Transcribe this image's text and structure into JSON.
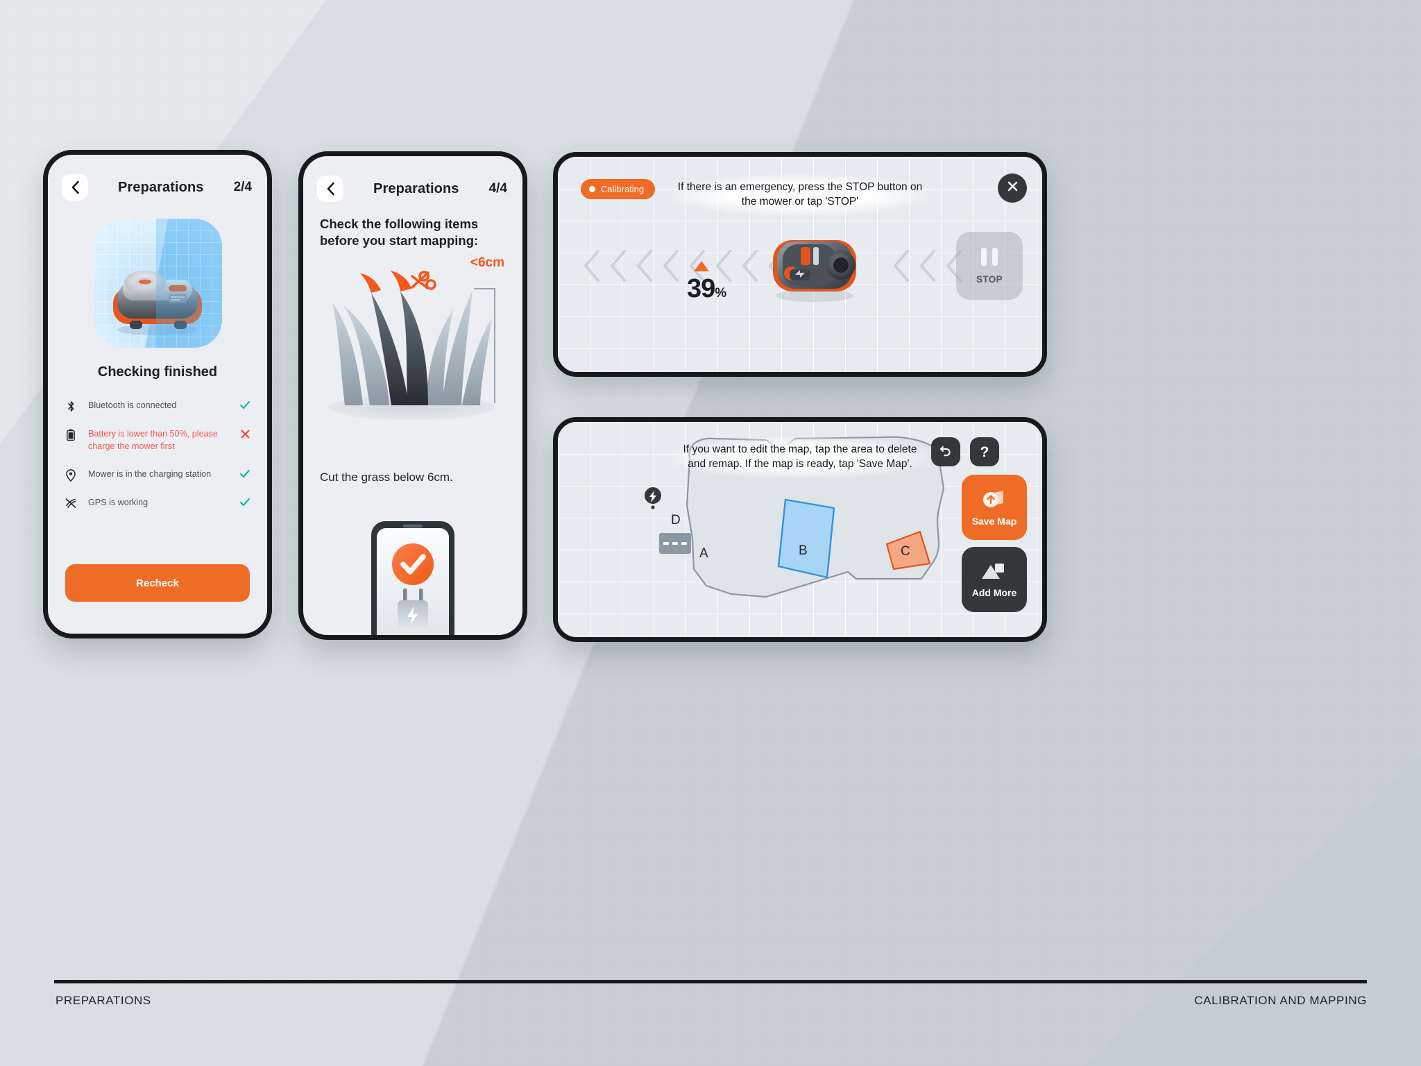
{
  "footer": {
    "left_label": "PREPARATIONS",
    "right_label": "CALIBRATION AND MAPPING"
  },
  "phone_preparations_2_4": {
    "back_icon": "chevron-left-icon",
    "title": "Preparations",
    "step": "2/4",
    "hero_image_alt": "robotic-lawn-mower",
    "status_heading": "Checking finished",
    "checklist": [
      {
        "icon": "bluetooth-icon",
        "text": "Bluetooth is connected",
        "state": "ok",
        "mark": "✓"
      },
      {
        "icon": "battery-icon",
        "text": "Battery is lower than 50%, please charge the mower first",
        "state": "error",
        "mark": "✕"
      },
      {
        "icon": "location-pin-icon",
        "text": "Mower is in the charging station",
        "state": "ok",
        "mark": "✓"
      },
      {
        "icon": "gps-signal-icon",
        "text": "GPS is working",
        "state": "ok",
        "mark": "✓"
      }
    ],
    "primary_button": "Recheck"
  },
  "phone_preparations_4_4": {
    "back_icon": "chevron-left-icon",
    "title": "Preparations",
    "step": "4/4",
    "heading": "Check the following items before you start mapping:",
    "measure_label": "<6cm",
    "caption": "Cut the grass below 6cm.",
    "illustration": "grass-with-scissors",
    "phone_mock_icon": "charging-phone-with-checkmark"
  },
  "panel_calibration": {
    "status_badge": "Calibrating",
    "hint": "If there is an emergency, press the STOP button on the mower or tap 'STOP'",
    "close_icon": "close-icon",
    "stop_button_label": "STOP",
    "progress_value": "39",
    "progress_unit": "%",
    "mower_icon": "mower-top-view"
  },
  "panel_mapping": {
    "hint": "If you want to edit the map, tap the area to delete and remap. If the map is ready, tap 'Save Map'.",
    "undo_icon": "undo-icon",
    "help_icon": "question-mark-icon",
    "save_map_label": "Save Map",
    "save_map_icon": "save-map-icon",
    "add_more_label": "Add More",
    "add_more_icon": "add-zone-icon",
    "charging_station_icon": "charging-station-icon",
    "zones": [
      {
        "id": "A",
        "type": "lawn",
        "color": "#dfe3e8"
      },
      {
        "id": "B",
        "type": "no-go-blue",
        "color": "#a8d5f5"
      },
      {
        "id": "C",
        "type": "no-go-orange",
        "color": "#f3a882"
      },
      {
        "id": "D",
        "type": "charging-dock",
        "color": "#8b98a4"
      }
    ]
  },
  "colors": {
    "accent_orange": "#ef6c26",
    "error_red": "#f9564f",
    "success_green": "#18b89a",
    "dark": "#34383b",
    "surface": "#eceef1"
  }
}
